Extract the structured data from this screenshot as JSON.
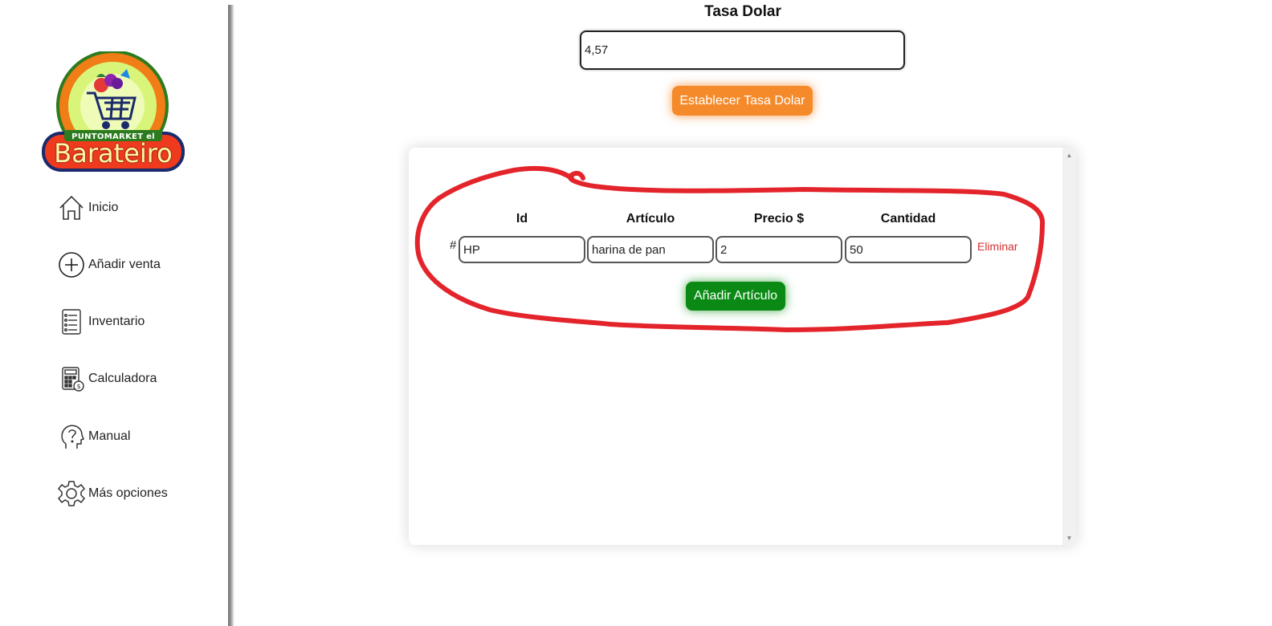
{
  "brand": {
    "logo_small_text": "PUNTOMARKET el",
    "logo_name": "Barateiro"
  },
  "sidebar": {
    "items": [
      {
        "label": "Inicio",
        "icon": "home-icon"
      },
      {
        "label": "Añadir venta",
        "icon": "plus-circle-icon"
      },
      {
        "label": "Inventario",
        "icon": "inventory-list-icon"
      },
      {
        "label": "Calculadora",
        "icon": "calculator-icon"
      },
      {
        "label": "Manual",
        "icon": "help-head-icon"
      },
      {
        "label": "Más opciones",
        "icon": "gear-icon"
      }
    ]
  },
  "rate": {
    "title": "Tasa Dolar",
    "value": "4,57",
    "button_label": "Establecer Tasa Dolar"
  },
  "table": {
    "headers": [
      "Id",
      "Artículo",
      "Precio $",
      "Cantidad"
    ],
    "rows": [
      {
        "hash": "#",
        "id": "HP",
        "article": "harina de pan",
        "price": "2",
        "quantity": "50",
        "delete_label": "Eliminar"
      }
    ],
    "add_button_label": "Añadir Artículo"
  },
  "colors": {
    "orange_button": "#f58a2a",
    "green_button": "#0a8a14",
    "delete_link": "#d32f2f",
    "annotation_stroke": "#e3242b"
  }
}
